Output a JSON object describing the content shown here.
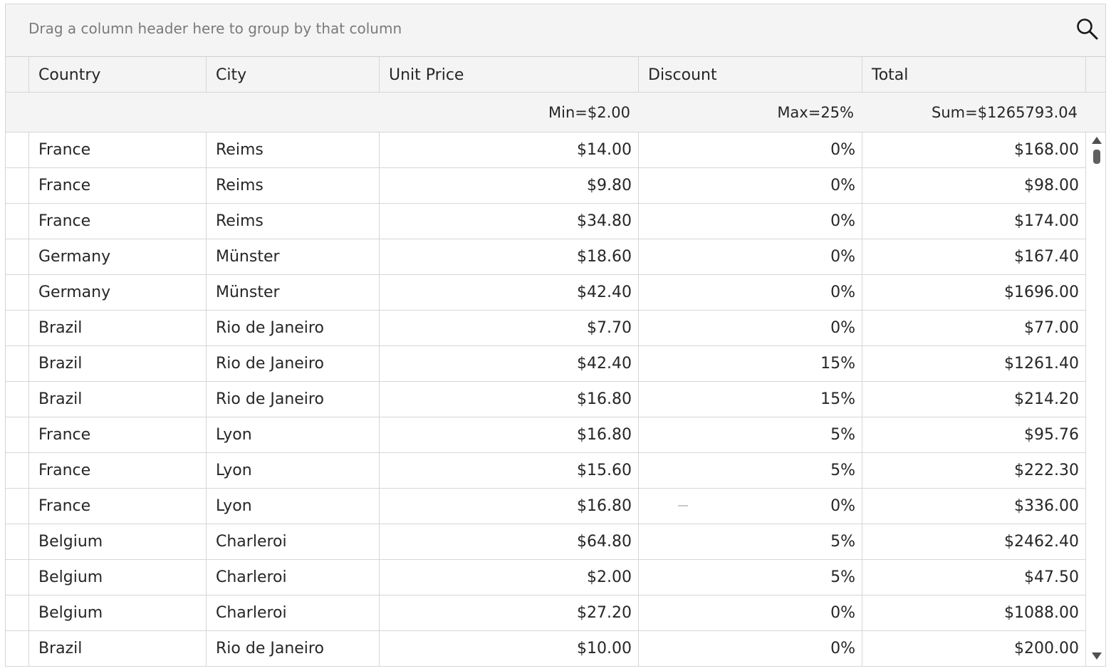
{
  "group_panel": {
    "hint": "Drag a column header here to group by that column",
    "search_icon": "search-icon"
  },
  "columns": [
    {
      "key": "country",
      "label": "Country"
    },
    {
      "key": "city",
      "label": "City"
    },
    {
      "key": "unit_price",
      "label": "Unit Price"
    },
    {
      "key": "discount",
      "label": "Discount"
    },
    {
      "key": "total",
      "label": "Total"
    }
  ],
  "aggregates": {
    "unit_price": "Min=$2.00",
    "discount": "Max=25%",
    "total": "Sum=$1265793.04"
  },
  "rows": [
    {
      "country": "France",
      "city": "Reims",
      "unit_price": "$14.00",
      "discount": "0%",
      "total": "$168.00"
    },
    {
      "country": "France",
      "city": "Reims",
      "unit_price": "$9.80",
      "discount": "0%",
      "total": "$98.00"
    },
    {
      "country": "France",
      "city": "Reims",
      "unit_price": "$34.80",
      "discount": "0%",
      "total": "$174.00"
    },
    {
      "country": "Germany",
      "city": "Münster",
      "unit_price": "$18.60",
      "discount": "0%",
      "total": "$167.40"
    },
    {
      "country": "Germany",
      "city": "Münster",
      "unit_price": "$42.40",
      "discount": "0%",
      "total": "$1696.00"
    },
    {
      "country": "Brazil",
      "city": "Rio de Janeiro",
      "unit_price": "$7.70",
      "discount": "0%",
      "total": "$77.00"
    },
    {
      "country": "Brazil",
      "city": "Rio de Janeiro",
      "unit_price": "$42.40",
      "discount": "15%",
      "total": "$1261.40"
    },
    {
      "country": "Brazil",
      "city": "Rio de Janeiro",
      "unit_price": "$16.80",
      "discount": "15%",
      "total": "$214.20"
    },
    {
      "country": "France",
      "city": "Lyon",
      "unit_price": "$16.80",
      "discount": "5%",
      "total": "$95.76"
    },
    {
      "country": "France",
      "city": "Lyon",
      "unit_price": "$15.60",
      "discount": "5%",
      "total": "$222.30"
    },
    {
      "country": "France",
      "city": "Lyon",
      "unit_price": "$16.80",
      "discount": "0%",
      "total": "$336.00"
    },
    {
      "country": "Belgium",
      "city": "Charleroi",
      "unit_price": "$64.80",
      "discount": "5%",
      "total": "$2462.40"
    },
    {
      "country": "Belgium",
      "city": "Charleroi",
      "unit_price": "$2.00",
      "discount": "5%",
      "total": "$47.50"
    },
    {
      "country": "Belgium",
      "city": "Charleroi",
      "unit_price": "$27.20",
      "discount": "0%",
      "total": "$1088.00"
    },
    {
      "country": "Brazil",
      "city": "Rio de Janeiro",
      "unit_price": "$10.00",
      "discount": "0%",
      "total": "$200.00"
    }
  ]
}
